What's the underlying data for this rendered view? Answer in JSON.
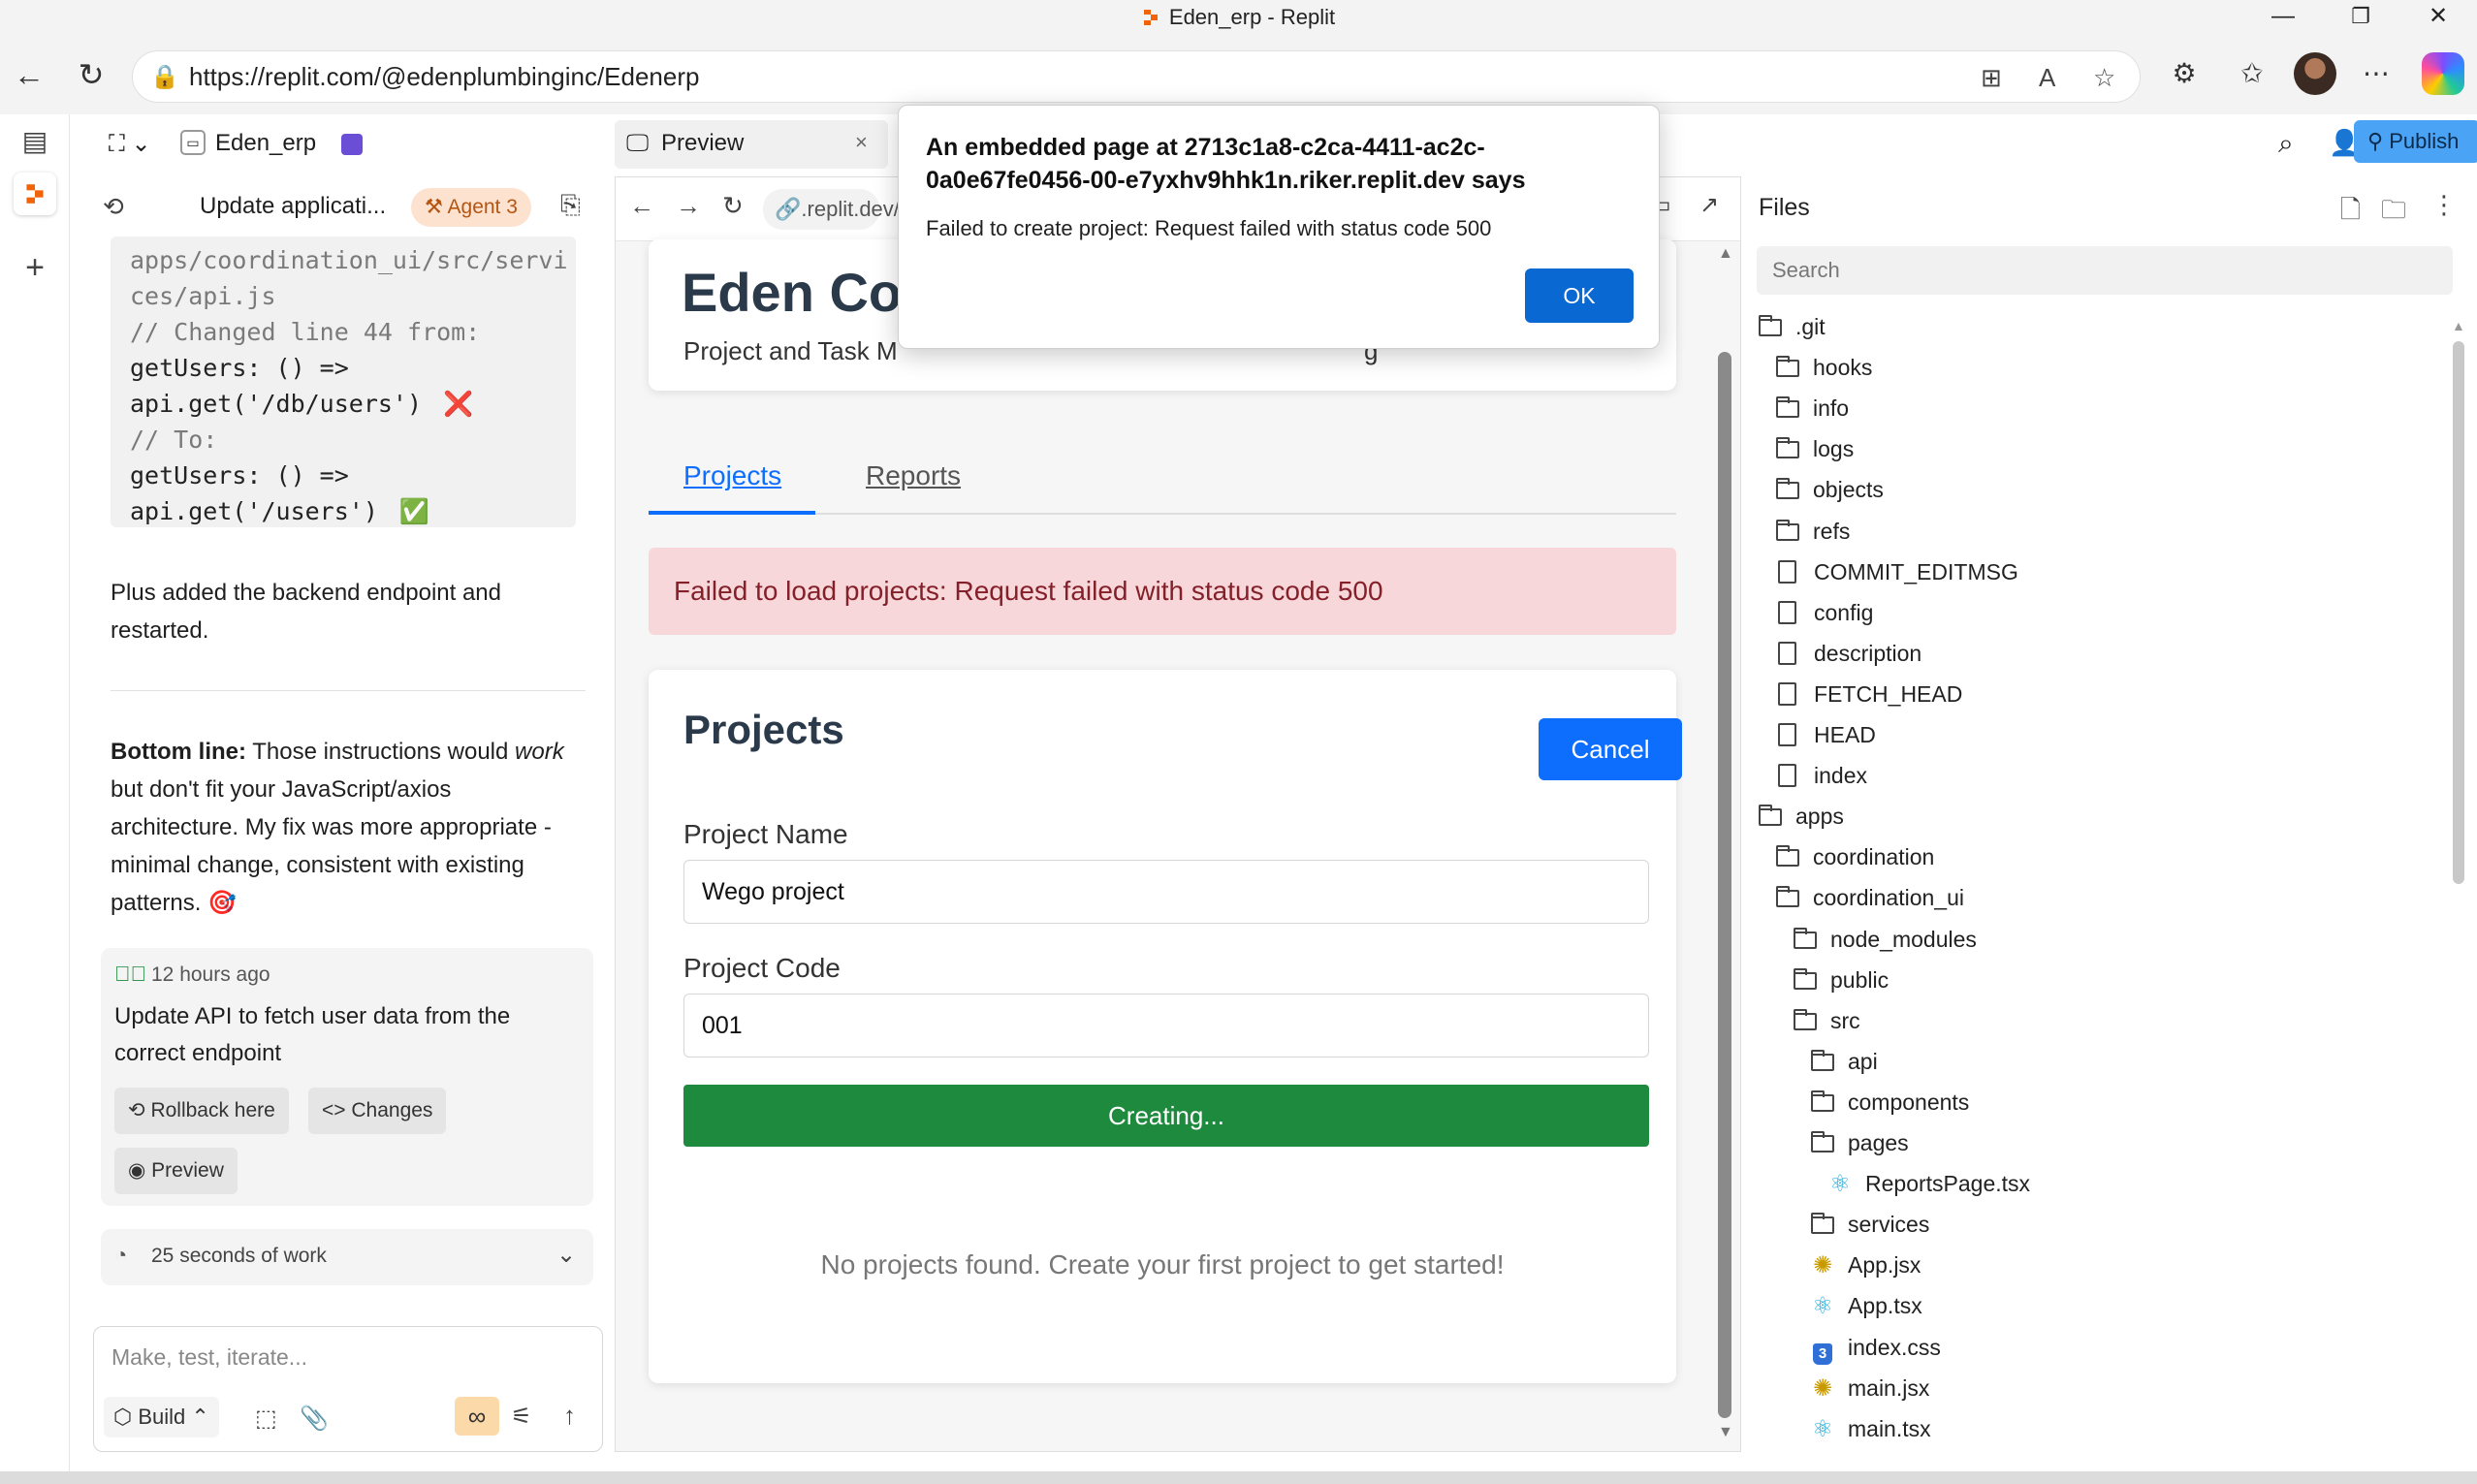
{
  "window": {
    "title": "Eden_erp - Replit",
    "min": "—",
    "restore": "❐",
    "close": "✕"
  },
  "browser": {
    "url": "https://replit.com/@edenplumbinginc/Edenerp"
  },
  "app_header": {
    "project_name": "Eden_erp",
    "preview_tab": "Preview",
    "publish_label": "Publish"
  },
  "chat": {
    "thread_title": "Update applicati...",
    "agent_badge": "Agent 3",
    "code_lines": [
      {
        "text": "apps/coordination_ui/src/servi",
        "style": "grey"
      },
      {
        "text": "ces/api.js",
        "style": "grey"
      },
      {
        "text": "// Changed line 44 from:",
        "style": "grey"
      },
      {
        "text": "getUsers: () =>",
        "style": "dark"
      },
      {
        "text": "api.get('/db/users')",
        "style": "dark",
        "mark": "❌"
      },
      {
        "text": "// To:",
        "style": "grey"
      },
      {
        "text": "getUsers: () =>",
        "style": "dark"
      },
      {
        "text": "api.get('/users')",
        "style": "dark",
        "mark": "✅"
      }
    ],
    "para1": "Plus added the backend endpoint and restarted.",
    "bottom_bold": "Bottom line:",
    "bottom_a": " Those instructions would ",
    "bottom_em": "work",
    "bottom_b": " but don't fit your JavaScript/axios architecture. My fix was more appropriate - minimal change, consistent with existing patterns. 🎯",
    "checkpoint_time": "12 hours ago",
    "checkpoint_text": "Update API to fetch user data from the correct endpoint",
    "rollback_label": "Rollback here",
    "changes_label": "Changes",
    "preview_label": "Preview",
    "work_time": "25 seconds of work",
    "composer_placeholder": "Make, test, iterate...",
    "build_label": "Build"
  },
  "preview": {
    "url_short": ".replit.dev/",
    "app_title": "Eden Coo",
    "app_subtitle": "Project and Task M",
    "app_subtitle_tail": "g",
    "tabs": [
      "Projects",
      "Reports"
    ],
    "error": "Failed to load projects: Request failed with status code 500",
    "form_title": "Projects",
    "cancel_label": "Cancel",
    "name_label": "Project Name",
    "name_value": "Wego project",
    "code_label": "Project Code",
    "code_value": "001",
    "creating_label": "Creating...",
    "empty_message": "No projects found. Create your first project to get started!"
  },
  "dialog": {
    "title": "An embedded page at 2713c1a8-c2ca-4411-ac2c-0a0e67fe0456-00-e7yxhv9hhk1n.riker.replit.dev says",
    "message": "Failed to create project: Request failed with status code 500",
    "ok_label": "OK"
  },
  "files": {
    "title": "Files",
    "search_placeholder": "Search",
    "tree": [
      {
        "name": ".git",
        "type": "folder-open",
        "depth": 0
      },
      {
        "name": "hooks",
        "type": "folder",
        "depth": 1
      },
      {
        "name": "info",
        "type": "folder",
        "depth": 1
      },
      {
        "name": "logs",
        "type": "folder",
        "depth": 1
      },
      {
        "name": "objects",
        "type": "folder",
        "depth": 1
      },
      {
        "name": "refs",
        "type": "folder",
        "depth": 1
      },
      {
        "name": "COMMIT_EDITMSG",
        "type": "file",
        "depth": 1
      },
      {
        "name": "config",
        "type": "file",
        "depth": 1
      },
      {
        "name": "description",
        "type": "file",
        "depth": 1
      },
      {
        "name": "FETCH_HEAD",
        "type": "file",
        "depth": 1
      },
      {
        "name": "HEAD",
        "type": "file",
        "depth": 1
      },
      {
        "name": "index",
        "type": "file",
        "depth": 1
      },
      {
        "name": "apps",
        "type": "folder-open",
        "depth": 0
      },
      {
        "name": "coordination",
        "type": "folder",
        "depth": 1
      },
      {
        "name": "coordination_ui",
        "type": "folder-open",
        "depth": 1
      },
      {
        "name": "node_modules",
        "type": "folder",
        "depth": 2
      },
      {
        "name": "public",
        "type": "folder",
        "depth": 2
      },
      {
        "name": "src",
        "type": "folder-open",
        "depth": 2
      },
      {
        "name": "api",
        "type": "folder",
        "depth": 3
      },
      {
        "name": "components",
        "type": "folder",
        "depth": 3
      },
      {
        "name": "pages",
        "type": "folder-open",
        "depth": 3
      },
      {
        "name": "ReportsPage.tsx",
        "type": "react",
        "depth": 4
      },
      {
        "name": "services",
        "type": "folder",
        "depth": 3
      },
      {
        "name": "App.jsx",
        "type": "js",
        "depth": 3
      },
      {
        "name": "App.tsx",
        "type": "react",
        "depth": 3
      },
      {
        "name": "index.css",
        "type": "css",
        "depth": 3
      },
      {
        "name": "main.jsx",
        "type": "js",
        "depth": 3
      },
      {
        "name": "main.tsx",
        "type": "react",
        "depth": 3
      }
    ]
  },
  "colors": {
    "accent_blue": "#0d6efd",
    "create_green": "#1e8a3d",
    "error_bg": "#f8d7da",
    "error_text": "#842029",
    "agent_badge_bg": "#fde2cf",
    "publish_bg": "#4aa3f5",
    "replit_orange": "#f26207"
  }
}
